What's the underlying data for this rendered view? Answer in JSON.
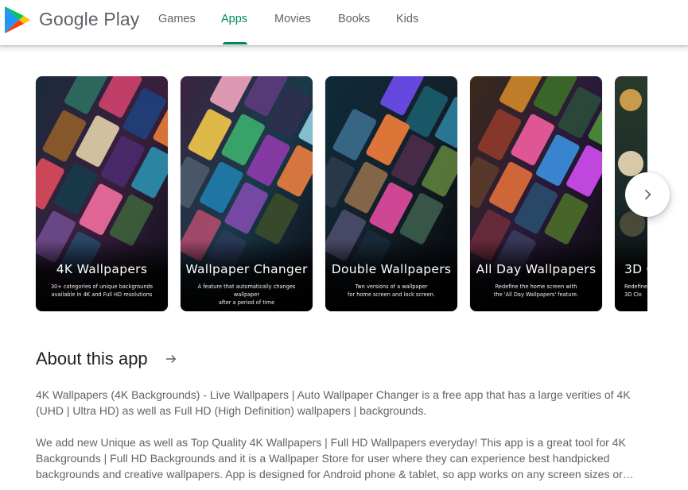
{
  "header": {
    "brand": "Google Play",
    "nav": [
      {
        "label": "Games"
      },
      {
        "label": "Apps"
      },
      {
        "label": "Movies"
      },
      {
        "label": "Books"
      },
      {
        "label": "Kids"
      }
    ],
    "active_nav": "Apps",
    "colors": {
      "active": "#01875f",
      "inactive": "#5f6368"
    }
  },
  "screenshots": [
    {
      "title": "4K Wallpapers",
      "subtitle_line1": "30+ categories of unique backgrounds",
      "subtitle_line2": "available in 4K and Full HD resolutions"
    },
    {
      "title": "Wallpaper Changer",
      "subtitle_line1": "A feature that automatically changes wallpaper",
      "subtitle_line2": "after a period of time"
    },
    {
      "title": "Double Wallpapers",
      "subtitle_line1": "Two versions of a wallpaper",
      "subtitle_line2": "for home screen and lock screen."
    },
    {
      "title": "All Day Wallpapers",
      "subtitle_line1": "Redefine the home screen with",
      "subtitle_line2": "the 'All Day Wallpapers' feature."
    },
    {
      "title": "3D C",
      "subtitle_line1": "Redefine t",
      "subtitle_line2": "3D Clo"
    }
  ],
  "carousel_next_icon": "chevron-right-icon",
  "about": {
    "title": "About this app",
    "arrow_icon": "arrow-right-icon",
    "paragraph1": "4K Wallpapers (4K Backgrounds) - Live Wallpapers | Auto Wallpaper Changer is a free app that has a large verities of 4K (UHD | Ultra HD) as well as Full HD (High Definition) wallpapers | backgrounds.",
    "paragraph2": "We add new Unique as well as Top Quality 4K Wallpapers | Full HD Wallpapers everyday! This app is a great tool for 4K Backgrounds | Full HD Backgrounds and it is a Wallpaper Store for user where they can experience best handpicked backgrounds and creative wallpapers. App is designed for Android phone & tablet, so app works on any screen sizes or…"
  }
}
